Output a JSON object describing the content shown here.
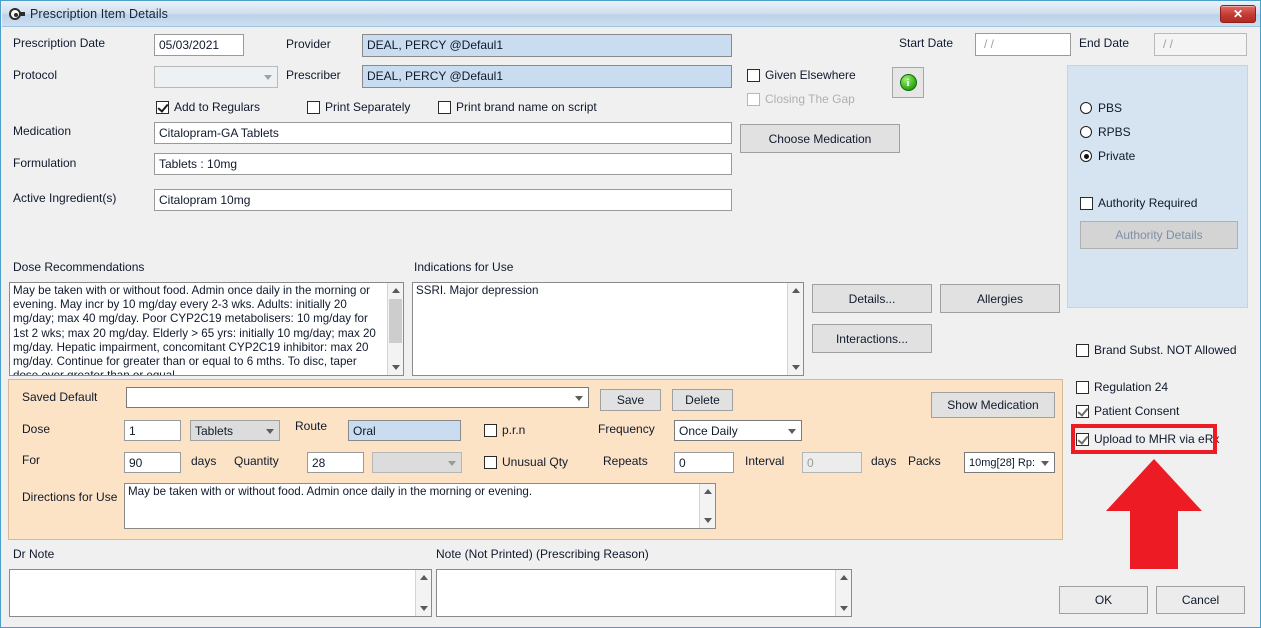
{
  "window": {
    "title": "Prescription Item Details",
    "icon": "prescription-icon",
    "close_label": "✕"
  },
  "form": {
    "prescription_date_label": "Prescription Date",
    "prescription_date_value": "05/03/2021",
    "protocol_label": "Protocol",
    "protocol_value": "",
    "provider_label": "Provider",
    "provider_value": "DEAL, PERCY @Defaul1",
    "prescriber_label": "Prescriber",
    "prescriber_value": "DEAL, PERCY @Defaul1",
    "start_date_label": "Start Date",
    "start_date_value": "/  /",
    "end_date_label": "End Date",
    "end_date_value": "/  /",
    "add_to_regulars_label": "Add to Regulars",
    "print_separately_label": "Print Separately",
    "print_brand_name_label": "Print brand name on script",
    "given_elsewhere_label": "Given Elsewhere",
    "closing_the_gap_label": "Closing The Gap",
    "info_button_label": "i",
    "medication_label": "Medication",
    "medication_value": "Citalopram-GA Tablets",
    "formulation_label": "Formulation",
    "formulation_value": "Tablets : 10mg",
    "active_ingredients_label": "Active Ingredient(s)",
    "active_ingredients_value": "Citalopram 10mg",
    "choose_medication_label": "Choose Medication"
  },
  "benefit": {
    "pbs_label": "PBS",
    "rpbs_label": "RPBS",
    "private_label": "Private",
    "selected": "Private",
    "authority_required_label": "Authority Required",
    "authority_details_label": "Authority Details"
  },
  "flags": {
    "brand_subst_label": "Brand Subst. NOT Allowed",
    "brand_subst_checked": false,
    "regulation_24_label": "Regulation 24",
    "regulation_24_checked": false,
    "patient_consent_label": "Patient Consent",
    "patient_consent_checked": true,
    "upload_mhr_label": "Upload to MHR via eRx",
    "upload_mhr_checked": true,
    "highlight_color": "#ed1b24"
  },
  "dose_recommendations": {
    "label": "Dose Recommendations",
    "text": "May be taken with or without food. Admin once daily in the morning or evening. May incr by 10 mg/day every 2-3 wks. Adults: initially 20 mg/day; max 40 mg/day. Poor CYP2C19 metabolisers: 10 mg/day for 1st 2 wks; max 20 mg/day. Elderly > 65 yrs: initially 10 mg/day; max 20 mg/day. Hepatic impairment, concomitant CYP2C19 inhibitor: max 20 mg/day. Continue for greater than or equal to 6 mths. To disc, taper dose over greater than or equal"
  },
  "indications": {
    "label": "Indications  for Use",
    "text": "SSRI. Major depression"
  },
  "side_buttons": {
    "details_label": "Details...",
    "allergies_label": "Allergies",
    "interactions_label": "Interactions..."
  },
  "dose_panel": {
    "saved_default_label": "Saved Default",
    "saved_default_value": "",
    "save_label": "Save",
    "delete_label": "Delete",
    "show_medication_label": "Show Medication",
    "dose_label": "Dose",
    "dose_value": "1",
    "dose_unit_value": "Tablets",
    "route_label": "Route",
    "route_value": "Oral",
    "prn_label": "p.r.n",
    "prn_checked": false,
    "frequency_label": "Frequency",
    "frequency_value": "Once Daily",
    "for_label": "For",
    "for_value": "90",
    "days_label": "days",
    "quantity_label": "Quantity",
    "quantity_value": "28",
    "quantity_unit_value": "",
    "unusual_qty_label": "Unusual Qty",
    "unusual_qty_checked": false,
    "repeats_label": "Repeats",
    "repeats_value": "0",
    "interval_label": "Interval",
    "interval_value": "0",
    "interval_days_label": "days",
    "packs_label": "Packs",
    "packs_value": "10mg[28] Rp:",
    "directions_label": "Directions for Use",
    "directions_value": "May be taken with or without food. Admin once daily in the morning or evening."
  },
  "notes": {
    "dr_note_label": "Dr Note",
    "dr_note_value": "",
    "prescribing_reason_label": "Note (Not Printed) (Prescribing Reason)",
    "prescribing_reason_value": ""
  },
  "footer": {
    "ok_label": "OK",
    "cancel_label": "Cancel"
  }
}
